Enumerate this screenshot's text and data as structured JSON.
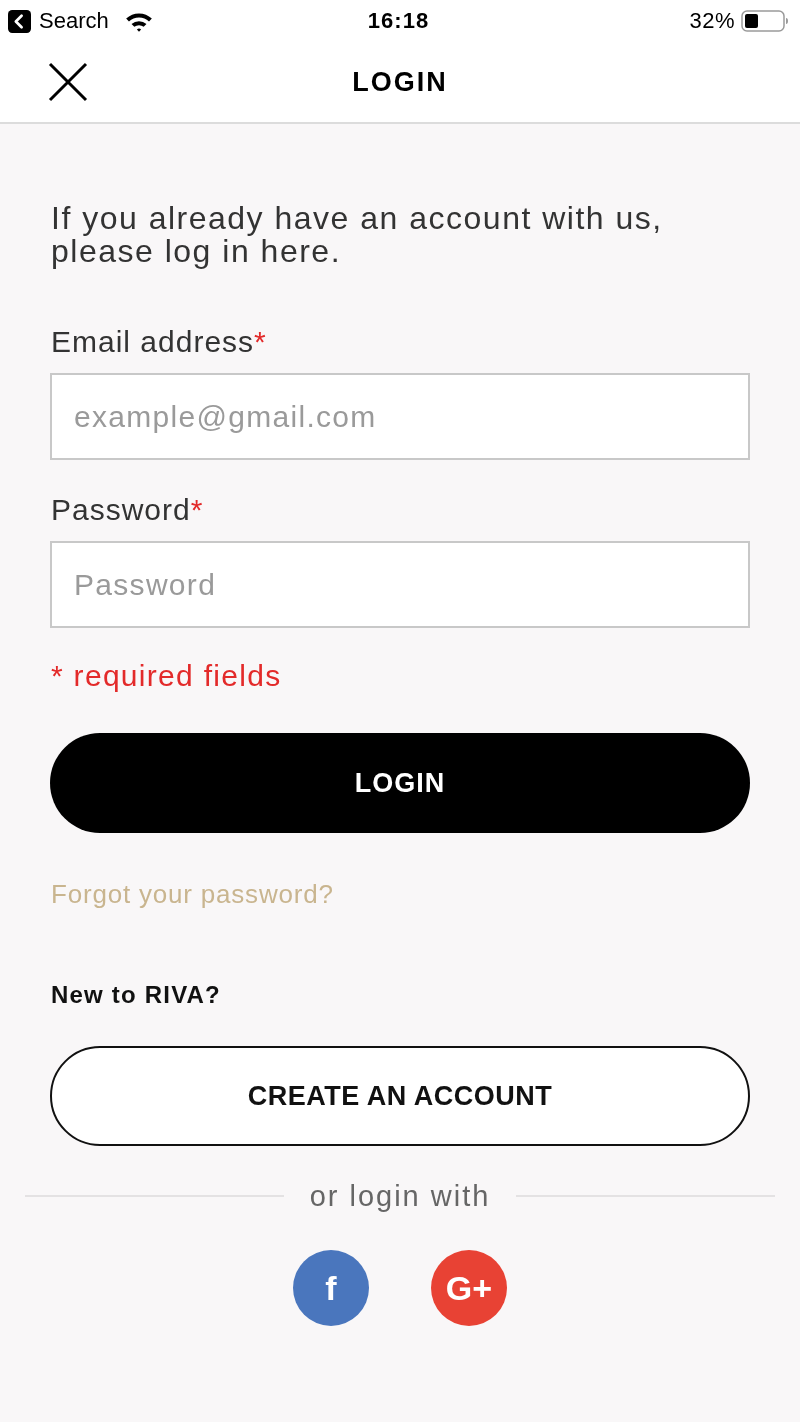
{
  "status_bar": {
    "back_label": "Search",
    "time": "16:18",
    "battery": "32%"
  },
  "header": {
    "title": "LOGIN"
  },
  "intro": "If you already have an account with us, please log in here.",
  "fields": [
    {
      "label": "Email address",
      "required_mark": "*",
      "placeholder": "example@gmail.com"
    },
    {
      "label": "Password",
      "required_mark": "*",
      "placeholder": "Password"
    }
  ],
  "required_note": "* required fields",
  "login_button": "LOGIN",
  "forgot_link": "Forgot your password?",
  "new_prompt": "New to RIVA?",
  "create_button": "CREATE AN ACCOUNT",
  "divider_label": "or login with",
  "social": [
    {
      "label": "f",
      "color": "#4a76bd"
    },
    {
      "label": "G+",
      "color": "#e84234"
    }
  ]
}
